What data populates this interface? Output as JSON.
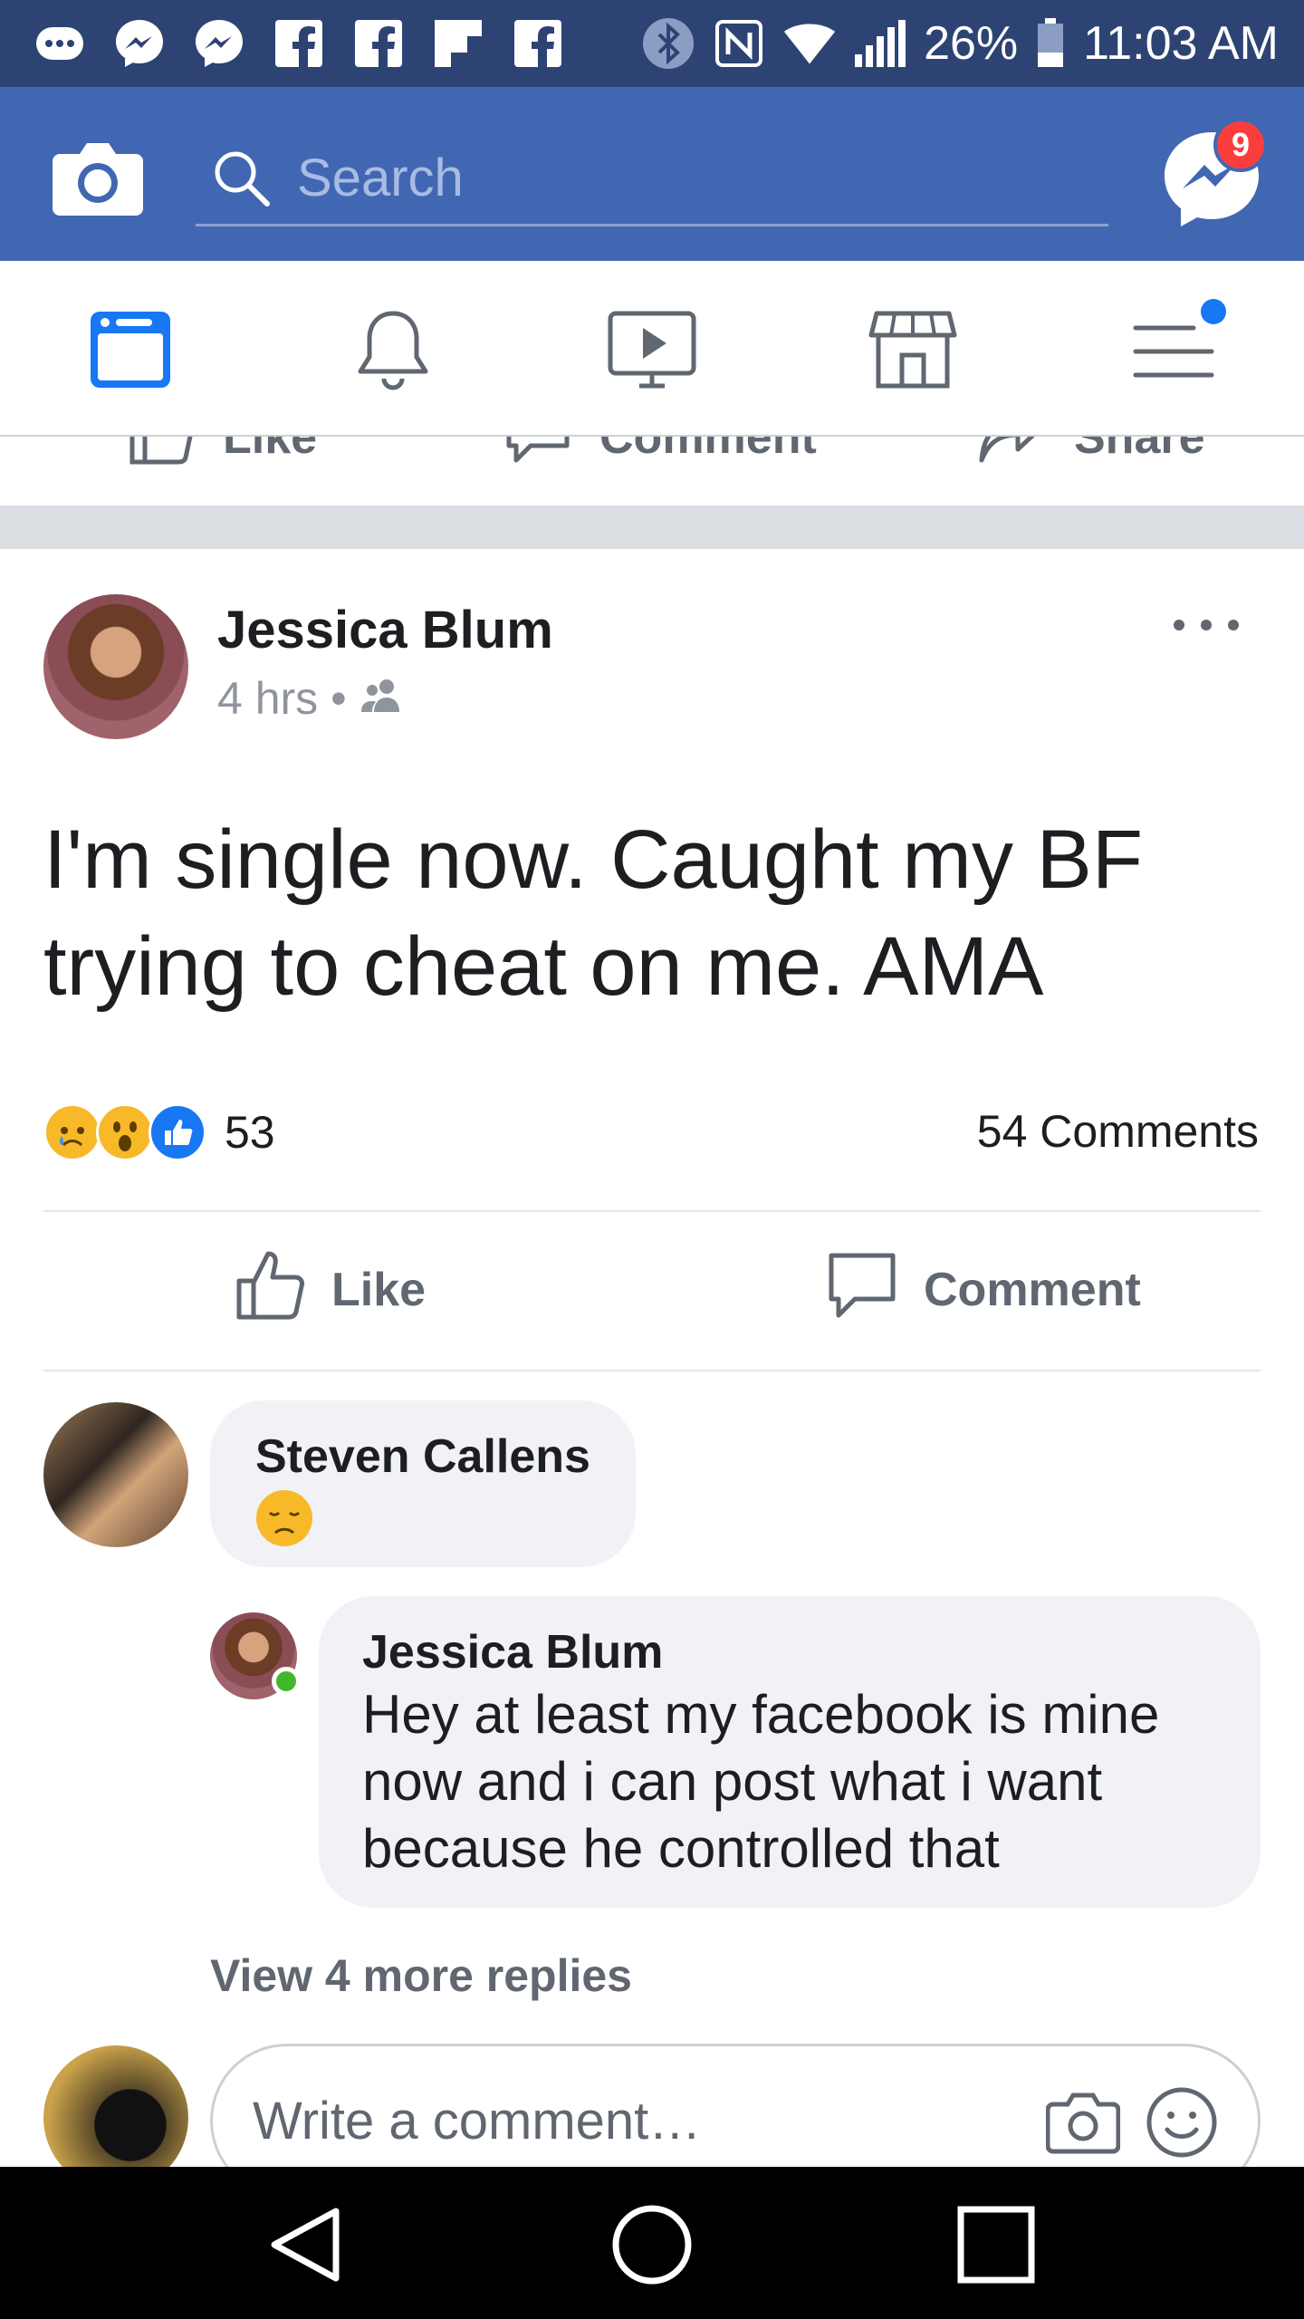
{
  "status_bar": {
    "battery": "26%",
    "time": "11:03 AM",
    "icons": [
      "more-notifications-icon",
      "messenger-icon",
      "messenger-icon",
      "facebook-icon",
      "facebook-icon",
      "flipboard-icon",
      "facebook-icon",
      "bluetooth-icon",
      "nfc-icon",
      "wifi-icon",
      "signal-icon",
      "battery-icon"
    ]
  },
  "header": {
    "search_placeholder": "Search",
    "messenger_badge": "9"
  },
  "tabs": [
    "news-feed-icon",
    "notifications-bell-icon",
    "watch-video-icon",
    "marketplace-icon",
    "menu-icon"
  ],
  "prev_post_actions": [
    "Like",
    "Comment",
    "Share"
  ],
  "post": {
    "author": "Jessica Blum",
    "time": "4 hrs",
    "separator": "•",
    "audience_icon": "friends-icon",
    "text": "I'm single now. Caught my BF trying to cheat on me. AMA",
    "reactions": [
      "sad",
      "wow",
      "like"
    ],
    "reaction_count": "53",
    "comment_count": "54 Comments",
    "actions": {
      "like": "Like",
      "comment": "Comment"
    }
  },
  "comments": [
    {
      "author": "Steven Callens",
      "text": "😞"
    },
    {
      "author": "Jessica Blum",
      "text": "Hey at least my facebook is mine now and i can post what i want because he controlled that"
    }
  ],
  "view_more_replies": "View 4 more replies",
  "composer": {
    "placeholder": "Write a comment…"
  },
  "colors": {
    "brand": "#4267b2",
    "status_bar": "#2d4373",
    "badge": "#fa3e3e",
    "active_tab": "#1877f2",
    "online": "#42b72a"
  }
}
